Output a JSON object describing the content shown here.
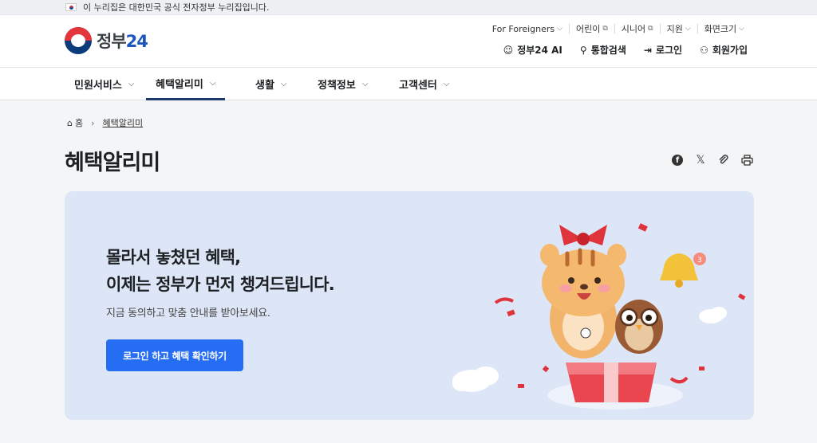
{
  "gov_banner": {
    "text": "이 누리집은 대한민국 공식 전자정부 누리집입니다."
  },
  "logo": {
    "text_main": "정부",
    "text_num": "24"
  },
  "util_links": [
    {
      "label": "For Foreigners",
      "icon": "chevron-down-icon",
      "glyph": "⌵"
    },
    {
      "label": "어린이",
      "icon": "external-link-icon",
      "glyph": "⧉"
    },
    {
      "label": "시니어",
      "icon": "external-link-icon",
      "glyph": "⧉"
    },
    {
      "label": "지원",
      "icon": "chevron-down-icon",
      "glyph": "⌵"
    },
    {
      "label": "화면크기",
      "icon": "chevron-down-icon",
      "glyph": "⌵"
    }
  ],
  "main_links": [
    {
      "label": "정부24 AI",
      "icon": "ai-mascot-icon",
      "glyph": "☺"
    },
    {
      "label": "통합검색",
      "icon": "search-icon",
      "glyph": "⚲"
    },
    {
      "label": "로그인",
      "icon": "login-icon",
      "glyph": "⇥"
    },
    {
      "label": "회원가입",
      "icon": "user-add-icon",
      "glyph": "⚇"
    }
  ],
  "nav": [
    {
      "label": "민원서비스",
      "active": false
    },
    {
      "label": "혜택알리미",
      "active": true
    },
    {
      "label": "생활",
      "active": false
    },
    {
      "label": "정책정보",
      "active": false
    },
    {
      "label": "고객센터",
      "active": false
    }
  ],
  "breadcrumb": {
    "home": "홈",
    "current": "혜택알리미"
  },
  "page_title": "혜택알리미",
  "share_tools": [
    "facebook-icon",
    "x-icon",
    "link-icon",
    "print-icon"
  ],
  "hero": {
    "line1": "몰라서 놓쳤던 혜택,",
    "line2": "이제는 정부가 먼저 챙겨드립니다.",
    "sub": "지금 동의하고 맞춤 안내를 받아보세요.",
    "button": "로그인 하고 혜택 확인하기"
  },
  "colors": {
    "accent": "#256ef4",
    "hero_bg": "#dde6f7",
    "nav_active": "#1d3a6e"
  }
}
